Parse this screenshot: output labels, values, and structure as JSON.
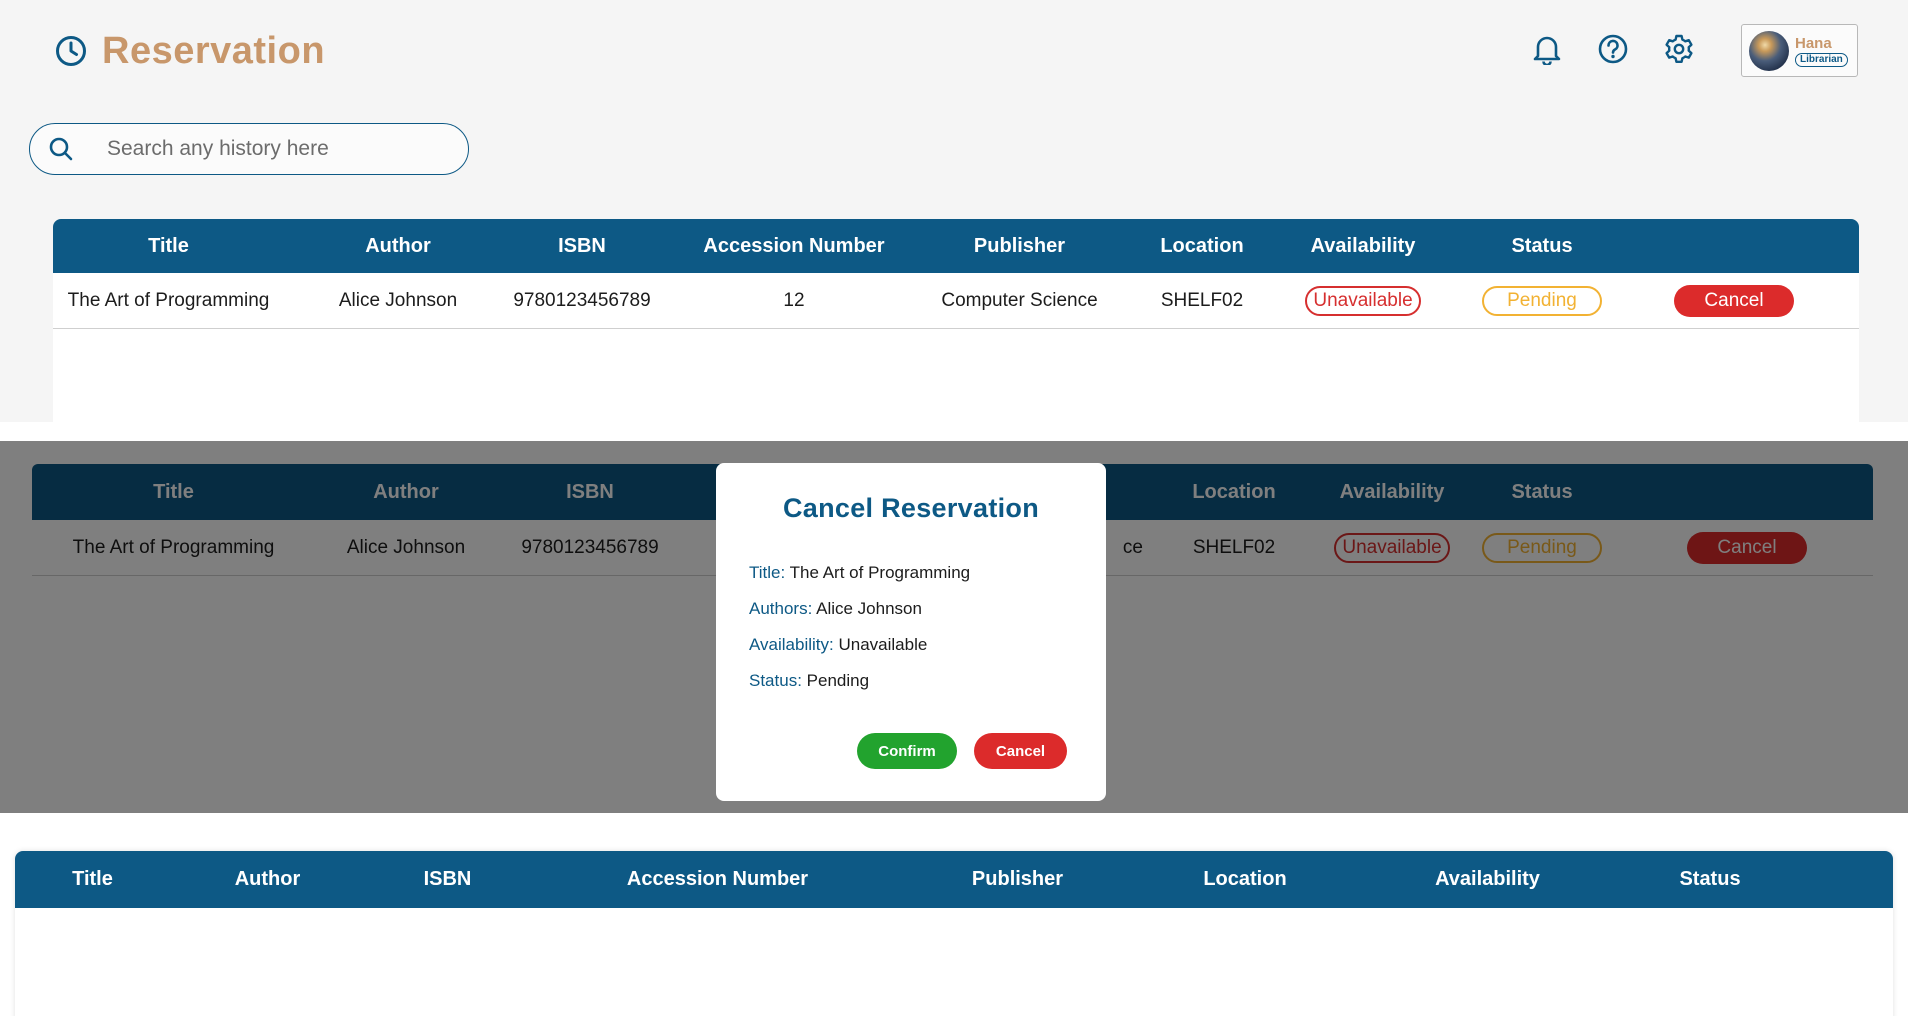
{
  "header": {
    "title": "Reservation",
    "icons": [
      "clock-icon",
      "bell-icon",
      "help-icon",
      "gear-icon"
    ],
    "user": {
      "name": "Hana",
      "role": "Librarian"
    }
  },
  "search": {
    "placeholder": "Search any history here",
    "value": ""
  },
  "table": {
    "columns": [
      "Title",
      "Author",
      "ISBN",
      "Accession Number",
      "Publisher",
      "Location",
      "Availability",
      "Status"
    ],
    "rows": [
      {
        "title": "The Art of Programming",
        "author": "Alice Johnson",
        "isbn": "9780123456789",
        "accession": "12",
        "publisher": "Computer Science",
        "location": "SHELF02",
        "availability": "Unavailable",
        "status": "Pending",
        "action": "Cancel"
      }
    ]
  },
  "panel2": {
    "row_publisher_fragment": "ce"
  },
  "modal": {
    "title": "Cancel Reservation",
    "fields": [
      {
        "label": "Title:",
        "value": "The Art of Programming"
      },
      {
        "label": "Authors:",
        "value": "Alice Johnson"
      },
      {
        "label": "Availability:",
        "value": "Unavailable"
      },
      {
        "label": "Status:",
        "value": "Pending"
      }
    ],
    "confirm_label": "Confirm",
    "cancel_label": "Cancel"
  },
  "colors": {
    "primary": "#0d5985",
    "accent": "#c8976b",
    "danger": "#dc2b2b",
    "warning": "#f2b233",
    "success": "#22a32e"
  }
}
